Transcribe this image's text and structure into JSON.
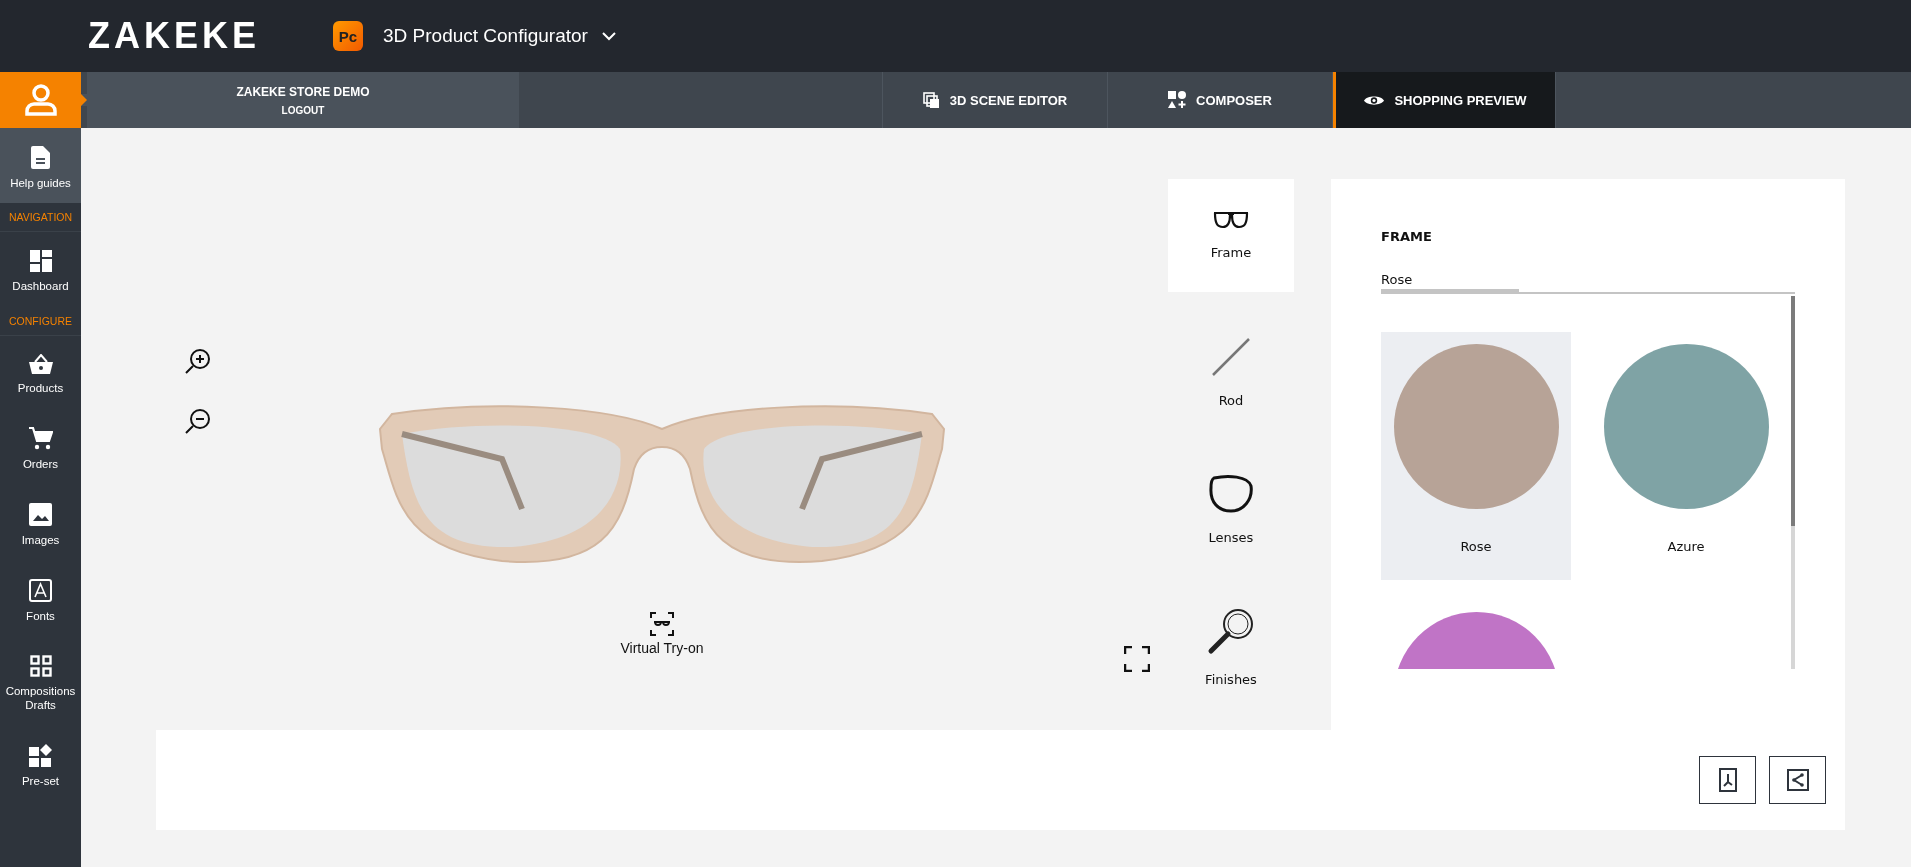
{
  "header": {
    "logo": "ZAKEKE",
    "app_badge": "Pc",
    "app_name": "3D Product Configurator"
  },
  "account": {
    "store": "ZAKEKE STORE DEMO",
    "logout": "LOGOUT"
  },
  "top_tabs": [
    {
      "label": "3D SCENE EDITOR",
      "selected": false
    },
    {
      "label": "COMPOSER",
      "selected": false
    },
    {
      "label": "SHOPPING PREVIEW",
      "selected": true
    }
  ],
  "sidebar": [
    {
      "kind": "item",
      "label": "Help guides",
      "selected": true
    },
    {
      "kind": "section",
      "label": "NAVIGATION"
    },
    {
      "kind": "item",
      "label": "Dashboard",
      "selected": false
    },
    {
      "kind": "section",
      "label": "CONFIGURE"
    },
    {
      "kind": "item",
      "label": "Products",
      "selected": false
    },
    {
      "kind": "item",
      "label": "Orders",
      "selected": false
    },
    {
      "kind": "item",
      "label": "Images",
      "selected": false
    },
    {
      "kind": "item",
      "label": "Fonts",
      "selected": false
    },
    {
      "kind": "item",
      "label": "Compositions Drafts",
      "selected": false
    },
    {
      "kind": "item",
      "label": "Pre-set",
      "selected": false
    }
  ],
  "stage": {
    "virtual_try_on": "Virtual Try-on"
  },
  "steps": [
    {
      "label": "Frame",
      "selected": true
    },
    {
      "label": "Rod",
      "selected": false
    },
    {
      "label": "Lenses",
      "selected": false
    },
    {
      "label": "Finishes",
      "selected": false
    }
  ],
  "panel": {
    "title": "FRAME",
    "tabs": [
      {
        "label": "Rose",
        "selected": true
      }
    ],
    "swatches": [
      {
        "label": "Rose",
        "color": "#b7a397",
        "selected": true
      },
      {
        "label": "Azure",
        "color": "#7fa3a5",
        "selected": false
      },
      {
        "color": "#c074c6",
        "selected": false
      }
    ]
  }
}
